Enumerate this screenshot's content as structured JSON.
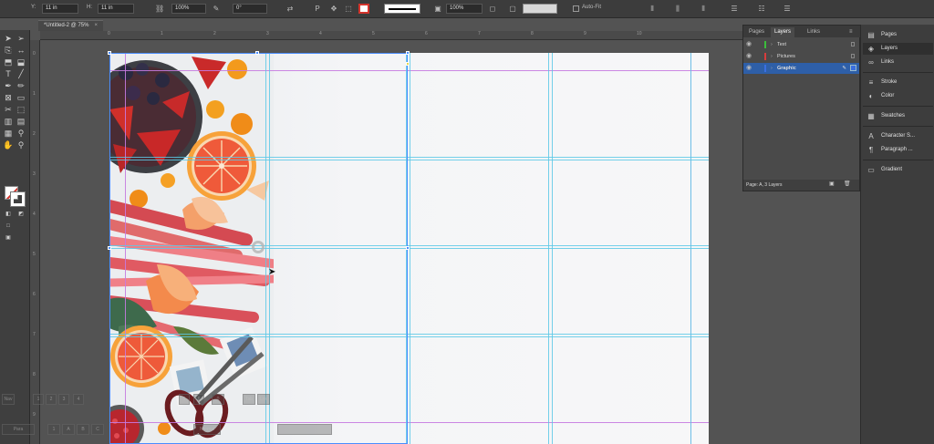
{
  "control_bar": {
    "width_value": "11 in",
    "height_value": "11 in",
    "x_label": "Y:",
    "h_label": "H:",
    "scale_x": "100%",
    "scale_y": "100%",
    "rotate": "0°",
    "shear": "0°",
    "opacity": "100%",
    "auto_fit_label": "Auto-Fit"
  },
  "document_tab": {
    "title": "*Untitled-2 @ 75%",
    "close": "×"
  },
  "ruler": {
    "h_ticks": [
      "0",
      "1",
      "2",
      "3",
      "4",
      "5",
      "6",
      "7",
      "8",
      "9",
      "10"
    ],
    "v_ticks": [
      "0",
      "1",
      "2",
      "3",
      "4",
      "5",
      "6",
      "7",
      "8",
      "9"
    ]
  },
  "layers_panel": {
    "tabs": [
      "Pages",
      "Layers",
      "Links"
    ],
    "active_tab": "Layers",
    "layers": [
      {
        "name": "Text",
        "color": "#3bbd3b",
        "selected": false
      },
      {
        "name": "Pictures",
        "color": "#d83c3c",
        "selected": false
      },
      {
        "name": "Graphic",
        "color": "#3a6fe0",
        "selected": true
      }
    ],
    "footer": "Page: A, 3 Layers"
  },
  "dock": {
    "items": [
      {
        "label": "Pages",
        "icon": "pages-icon",
        "glyph": "▤"
      },
      {
        "label": "Layers",
        "icon": "layers-icon",
        "glyph": "◈"
      },
      {
        "label": "Links",
        "icon": "links-icon",
        "glyph": "∞"
      },
      {
        "label": "Stroke",
        "icon": "stroke-icon",
        "glyph": "≡"
      },
      {
        "label": "Color",
        "icon": "color-icon",
        "glyph": "◐"
      },
      {
        "label": "Swatches",
        "icon": "swatches-icon",
        "glyph": "▦"
      },
      {
        "label": "Character S...",
        "icon": "character-styles-icon",
        "glyph": "A"
      },
      {
        "label": "Paragraph ...",
        "icon": "paragraph-styles-icon",
        "glyph": "¶"
      },
      {
        "label": "Gradient",
        "icon": "gradient-icon",
        "glyph": "▭"
      }
    ]
  },
  "ghost_bar": {
    "row1": [
      "Nav",
      "1",
      "2",
      "3",
      "4",
      "5",
      "6"
    ],
    "row2": [
      "0",
      "Normal",
      "Tab",
      "Lnk"
    ],
    "row3": [
      "Para",
      "1",
      "A",
      "B",
      "C"
    ]
  },
  "colors": {
    "guide_column": "#5cc8e6",
    "guide_margin": "#c77ae0",
    "selection": "#4a8dff",
    "fill_swatch_slash": "#d4342c"
  }
}
